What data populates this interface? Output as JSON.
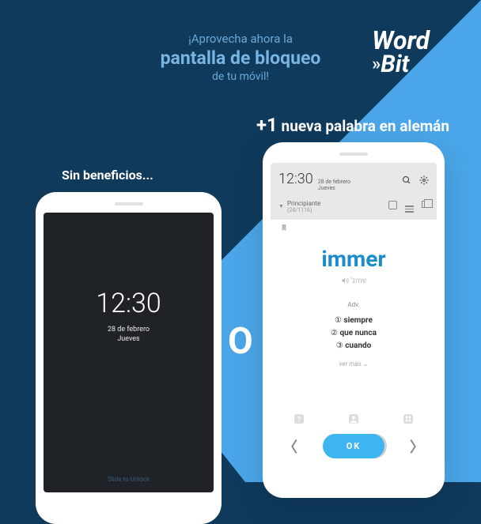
{
  "banner": {
    "top": "¡Aprovecha ahora la",
    "mid": "pantalla de bloqueo",
    "sub": "de tu móvil!"
  },
  "brand": {
    "line1": "Word",
    "line2": "Bit",
    "chev": "»"
  },
  "tagline": {
    "plus": "+1",
    "text": " nueva palabra en alemán"
  },
  "label_noben": "Sin beneficios...",
  "divider": "O",
  "phone1": {
    "time": "12:30",
    "date": "28 de febrero",
    "day": "Jueves",
    "slide": "Slide to Unlock"
  },
  "phone2": {
    "time": "12:30",
    "date": "28 de febrero",
    "day": "Jueves",
    "level": "Principiante",
    "level_sub": "(24/1116)",
    "word": "immer",
    "pron": "'ɪmɐ",
    "pos": "Adv.",
    "defs": [
      "siempre",
      "que nunca",
      "cuando"
    ],
    "def_nums": [
      "①",
      "②",
      "③"
    ],
    "more": "ver más",
    "ok": "OK"
  }
}
